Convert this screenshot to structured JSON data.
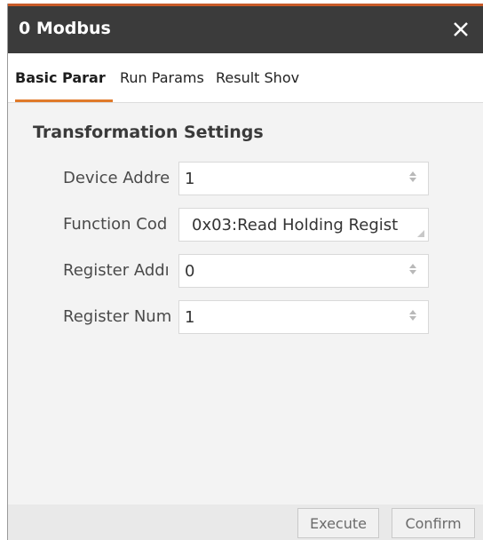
{
  "window": {
    "title": "0 Modbus"
  },
  "tabs": [
    {
      "label": "Basic Parar",
      "active": true
    },
    {
      "label": "Run Params",
      "active": false
    },
    {
      "label": "Result Shov",
      "active": false
    }
  ],
  "section": {
    "title": "Transformation Settings"
  },
  "fields": [
    {
      "label": "Device Addre",
      "value": "1",
      "control": "spinbox"
    },
    {
      "label": "Function Cod",
      "value": "0x03:Read Holding Regist",
      "control": "select"
    },
    {
      "label": "Register Addı",
      "value": "0",
      "control": "spinbox"
    },
    {
      "label": "Register Num",
      "value": "1",
      "control": "spinbox"
    }
  ],
  "footer": {
    "execute_label": "Execute",
    "confirm_label": "Confirm"
  },
  "colors": {
    "titlebar": "#3b3b3b",
    "accent": "#e07a2a",
    "panel": "#f3f3f3"
  },
  "icons": {
    "close": "close-icon",
    "spin": "spin-arrows-icon"
  }
}
